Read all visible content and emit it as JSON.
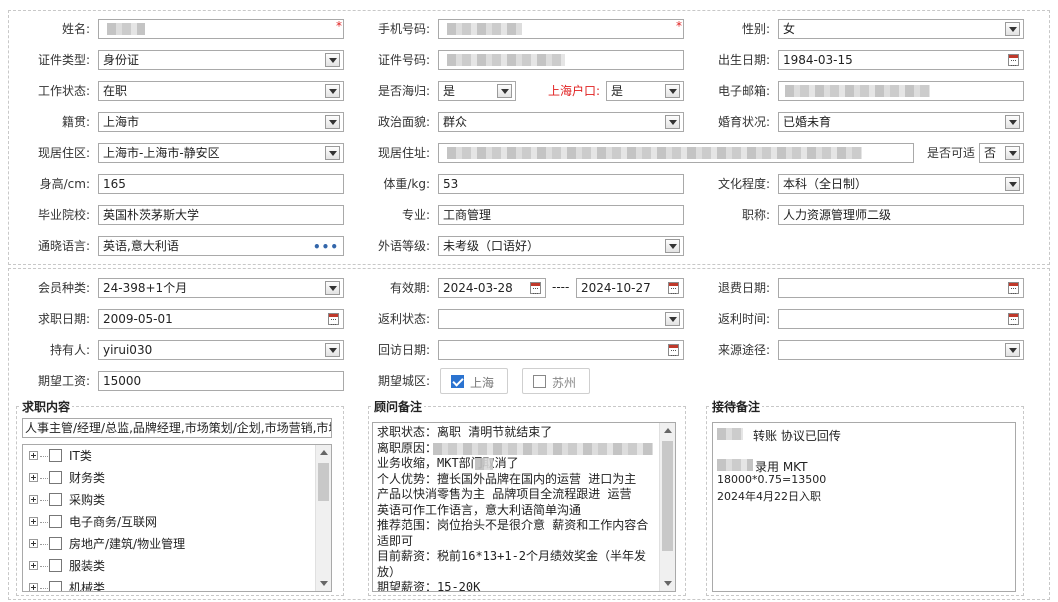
{
  "personal": {
    "name_label": "姓名:",
    "phone_label": "手机号码:",
    "gender_label": "性别:",
    "gender_value": "女",
    "id_type_label": "证件类型:",
    "id_type_value": "身份证",
    "id_number_label": "证件号码:",
    "birth_label": "出生日期:",
    "birth_value": "1984-03-15",
    "work_status_label": "工作状态:",
    "work_status_value": "在职",
    "returnee_label": "是否海归:",
    "returnee_value": "是",
    "shanghai_hukou_label": "上海户口:",
    "shanghai_hukou_value": "是",
    "email_label": "电子邮箱:",
    "native_label": "籍贯:",
    "native_value": "上海市",
    "political_label": "政治面貌:",
    "political_value": "群众",
    "marital_label": "婚育状况:",
    "marital_value": "已婚未育",
    "district_label": "现居住区:",
    "district_value": "上海市-上海市-静安区",
    "address_label": "现居住址:",
    "visible_label": "是否可适",
    "visible_value": "否",
    "height_label": "身高/cm:",
    "height_value": "165",
    "weight_label": "体重/kg:",
    "weight_value": "53",
    "education_label": "文化程度:",
    "education_value": "本科（全日制）",
    "school_label": "毕业院校:",
    "school_value": "英国朴茨茅斯大学",
    "major_label": "专业:",
    "major_value": "工商管理",
    "title_label": "职称:",
    "title_value": "人力资源管理师二级",
    "language_label": "通晓语言:",
    "language_value": "英语,意大利语",
    "language_more": "•••",
    "foreign_level_label": "外语等级:",
    "foreign_level_value": "未考级（口语好）"
  },
  "membership": {
    "member_type_label": "会员种类:",
    "member_type_value": "24-398+1个月",
    "validity_label": "有效期:",
    "validity_start": "2024-03-28",
    "validity_sep": "----",
    "validity_end": "2024-10-27",
    "refund_date_label": "退费日期:",
    "job_date_label": "求职日期:",
    "job_date_value": "2009-05-01",
    "rebate_status_label": "返利状态:",
    "rebate_time_label": "返利时间:",
    "holder_label": "持有人:",
    "holder_value": "yirui030",
    "revisit_label": "回访日期:",
    "source_label": "来源途径:",
    "salary_label": "期望工资:",
    "salary_value": "15000",
    "city_label": "期望城区:",
    "city_options": [
      {
        "label": "上海",
        "checked": true
      },
      {
        "label": "苏州",
        "checked": false
      }
    ]
  },
  "job_content": {
    "legend": "求职内容",
    "summary": "人事主管/经理/总监,品牌经理,市场策划/企划,市场营销,市场",
    "categories": [
      "IT类",
      "财务类",
      "采购类",
      "电子商务/互联网",
      "房地产/建筑/物业管理",
      "服装类",
      "机械类"
    ]
  },
  "consultant_notes": {
    "legend": "顾问备注",
    "text": "求职状态：离职 清明节就结束了\n离职原因：\n业务收缩，MKT部门取消了\n个人优势：擅长国外品牌在国内的运营 进口为主 产品以快消零售为主 品牌项目全流程跟进 运营  英语可作工作语言，意大利语简单沟通\n推荐范围：岗位抬头不是很介意 薪资和工作内容合适即可\n目前薪资：税前16*13+1-2个月绩效奖金（半年发放）\n期望薪资：15-20K"
  },
  "reception_notes": {
    "legend": "接待备注",
    "line1": "转账  协议已回传",
    "line2": "录用  MKT",
    "line3": "18000*0.75=13500",
    "line4": "2024年4月22日入职"
  },
  "required_mark": "*"
}
